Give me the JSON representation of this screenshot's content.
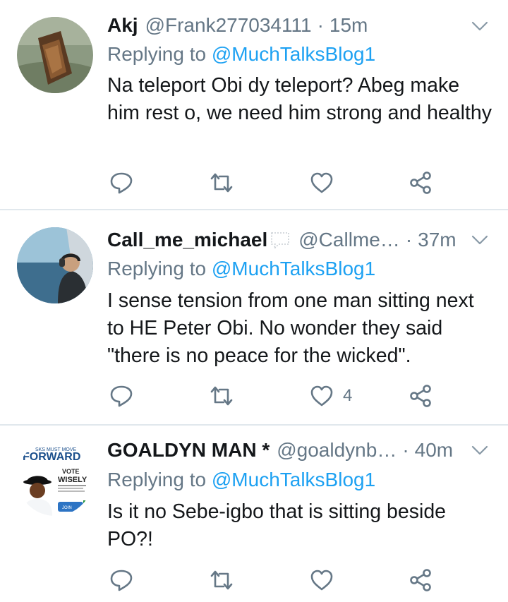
{
  "tweets": [
    {
      "name": "Akj",
      "handle": "@Frank277034111",
      "separator": "·",
      "time": "15m",
      "replying_prefix": "Replying to",
      "replying_to": "@MuchTalksBlog1",
      "text": "Na teleport Obi dy teleport? Abeg make him rest o, we need him strong and healthy",
      "like_count": ""
    },
    {
      "name": "Call_me_michael",
      "handle": "@Callme…",
      "separator": "·",
      "time": "37m",
      "replying_prefix": "Replying to",
      "replying_to": "@MuchTalksBlog1",
      "text": "I sense tension from one man sitting next to HE Peter Obi. No wonder they said \"there is no peace for the wicked\".",
      "like_count": "4"
    },
    {
      "name": "GOALDYN MAN *",
      "handle": "@goaldynb…",
      "separator": "·",
      "time": "40m",
      "replying_prefix": "Replying to",
      "replying_to": "@MuchTalksBlog1",
      "text": "Is it no Sebe-igbo that is sitting beside PO?!",
      "like_count": ""
    }
  ],
  "avatar3_text": {
    "top": "SKS MUST MOVE",
    "brand": "FORWARD",
    "vote": "VOTE",
    "wisely": "WISELY",
    "join": "JOIN"
  },
  "icons": [
    "reply-icon",
    "retweet-icon",
    "like-icon",
    "share-icon",
    "chevron-down-icon"
  ],
  "colors": {
    "accent": "#1da1f2",
    "muted": "#657786",
    "text": "#14171a",
    "divider": "#e1e8ed"
  }
}
